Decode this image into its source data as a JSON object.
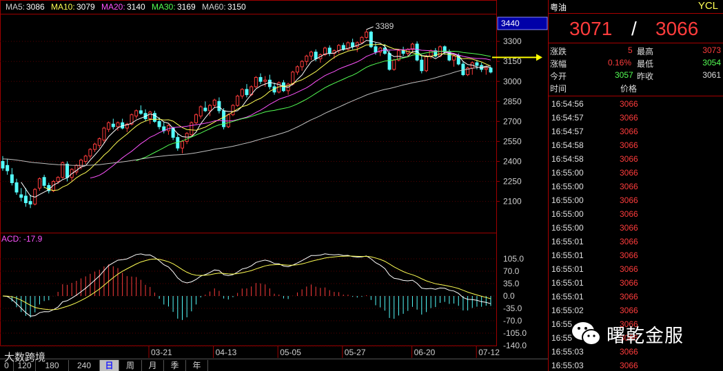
{
  "ma_legend": {
    "ma5_label": "MA5:",
    "ma5": "3086",
    "ma10_label": "MA10:",
    "ma10": "3079",
    "ma20_label": "MA20:",
    "ma20": "3140",
    "ma30_label": "MA30:",
    "ma30": "3169",
    "ma60_label": "MA60:",
    "ma60": "3150"
  },
  "macd_label": "ACD: -17.9",
  "current_price_box": "3440",
  "high_marker": "3389",
  "price_axis": [
    "3300",
    "3150",
    "3000",
    "2850",
    "2700",
    "2550",
    "2400",
    "2250",
    "2100"
  ],
  "macd_axis": [
    "105.0",
    "70.0",
    "35.0",
    "0.0",
    "-35.0",
    "-70.0",
    "-105.0",
    "-140.0"
  ],
  "date_axis": [
    "03-21",
    "04-13",
    "05-05",
    "05-27",
    "06-20",
    "07-12"
  ],
  "quote": {
    "name": "粤油",
    "code": "YCL",
    "bid": "3071",
    "sep": "/",
    "ask": "3066",
    "chg_label": "涨跌",
    "chg": "5",
    "high_label": "最高",
    "high": "3073",
    "pct_label": "涨幅",
    "pct": "0.16%",
    "low_label": "最低",
    "low": "3054",
    "open_label": "今开",
    "open": "3057",
    "prev_label": "昨收",
    "prev": "3061",
    "time_header": "时间",
    "price_header": "价格"
  },
  "ticks": [
    {
      "time": "16:54:56",
      "price": "3066"
    },
    {
      "time": "16:54:57",
      "price": "3066"
    },
    {
      "time": "16:54:57",
      "price": "3066"
    },
    {
      "time": "16:54:58",
      "price": "3066"
    },
    {
      "time": "16:54:58",
      "price": "3066"
    },
    {
      "time": "16:55:00",
      "price": "3066"
    },
    {
      "time": "16:55:00",
      "price": "3066"
    },
    {
      "time": "16:55:00",
      "price": "3066"
    },
    {
      "time": "16:55:00",
      "price": "3066"
    },
    {
      "time": "16:55:00",
      "price": "3066"
    },
    {
      "time": "16:55:01",
      "price": "3066"
    },
    {
      "time": "16:55:01",
      "price": "3066"
    },
    {
      "time": "16:55:01",
      "price": "3066"
    },
    {
      "time": "16:55:01",
      "price": "3066"
    },
    {
      "time": "16:55:01",
      "price": "3066"
    },
    {
      "time": "16:55:02",
      "price": "3066"
    },
    {
      "time": "16:55",
      "price": "3066"
    },
    {
      "time": "16:55",
      "price": "3066"
    },
    {
      "time": "16:55:03",
      "price": "3066"
    },
    {
      "time": "16:55:03",
      "price": "3066"
    }
  ],
  "periods": [
    "0",
    "120",
    "180",
    "240",
    "日",
    "周",
    "月",
    "季",
    "年"
  ],
  "active_period": "日",
  "watermark": "曙乾金服",
  "watermark2": "大数跨境",
  "colors": {
    "up": "#ff3c3c",
    "down": "#54fcfc",
    "ma5": "#ffffff",
    "ma10": "#ffff54",
    "ma20": "#ff54ff",
    "ma30": "#54ff54",
    "ma60": "#c0c0c0",
    "axis_red": "#a00000"
  }
}
